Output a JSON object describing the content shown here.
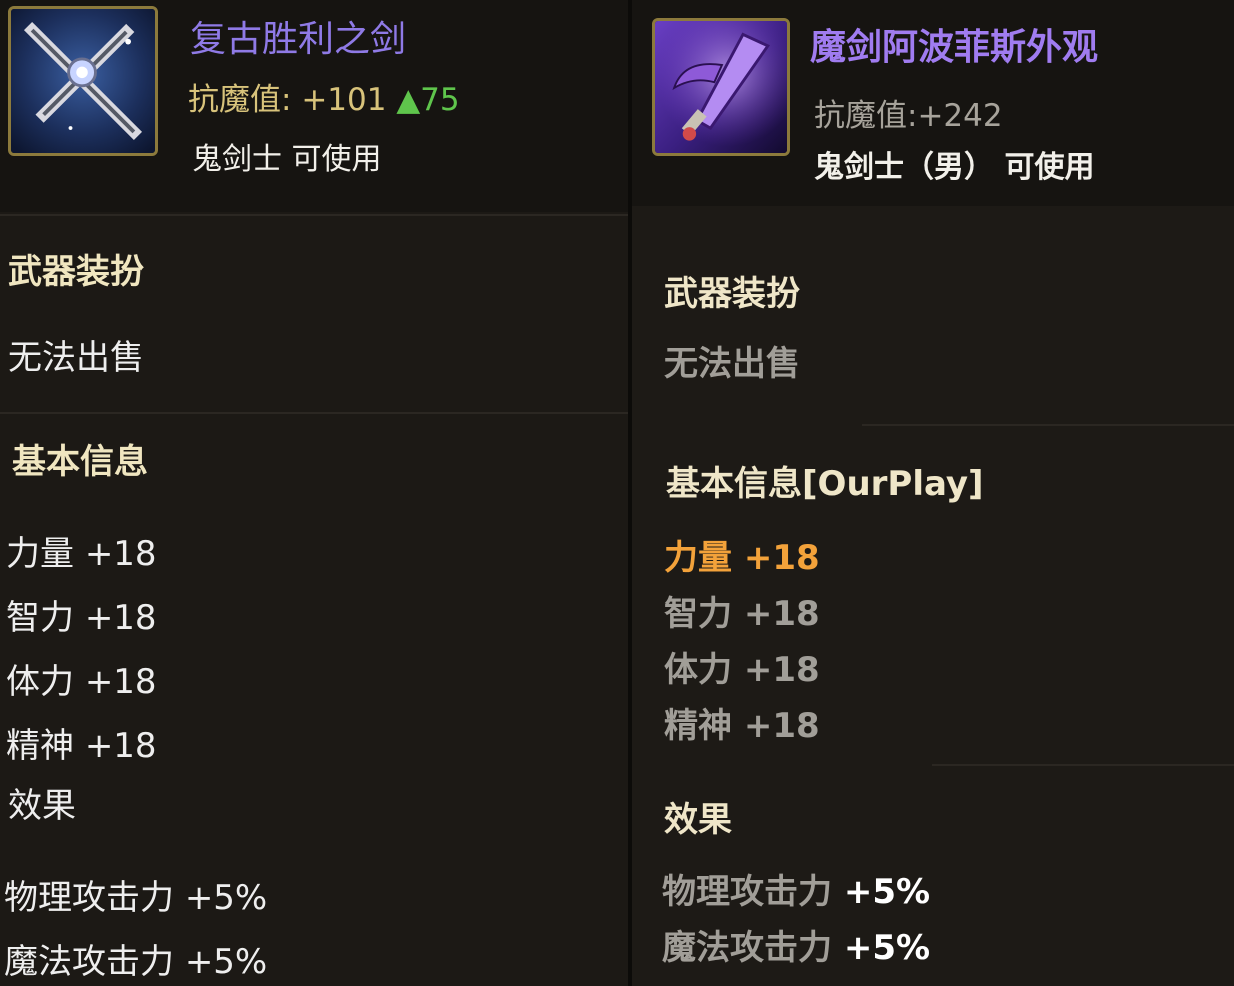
{
  "left": {
    "item_name": "复古胜利之剑",
    "resist_label": "抗魔值:",
    "resist_value": "+101",
    "resist_delta": "▲75",
    "usable_text": "鬼剑士 可使用",
    "category": "武器装扮",
    "trade": "无法出售",
    "basic_info_title": "基本信息",
    "stats": [
      {
        "label": "力量",
        "value": "+18"
      },
      {
        "label": "智力",
        "value": "+18"
      },
      {
        "label": "体力",
        "value": "+18"
      },
      {
        "label": "精神",
        "value": "+18"
      }
    ],
    "effects_title": "效果",
    "effects": [
      {
        "label": "物理攻击力",
        "value": "+5%"
      },
      {
        "label": "魔法攻击力",
        "value": "+5%"
      }
    ],
    "icon_name": "cross-sword-icon"
  },
  "right": {
    "item_name": "魔剑阿波菲斯外观",
    "resist_text": "抗魔值:+242",
    "usable_text": "鬼剑士（男） 可使用",
    "category": "武器装扮",
    "trade": "无法出售",
    "basic_info_title": "基本信息[OurPlay]",
    "stats": [
      {
        "label": "力量",
        "value": "+18"
      },
      {
        "label": "智力",
        "value": "+18"
      },
      {
        "label": "体力",
        "value": "+18"
      },
      {
        "label": "精神",
        "value": "+18"
      }
    ],
    "effects_title": "效果",
    "effects": [
      {
        "label": "物理攻击力",
        "value": "+5%"
      },
      {
        "label": "魔法攻击力",
        "value": "+5%"
      }
    ],
    "icon_name": "apophis-sword-icon"
  },
  "colors": {
    "item_name_purple": "#8f7ae6",
    "stat_gold": "#d8c37b",
    "increase_green": "#5fc54c",
    "highlight_orange": "#f3a23a"
  }
}
